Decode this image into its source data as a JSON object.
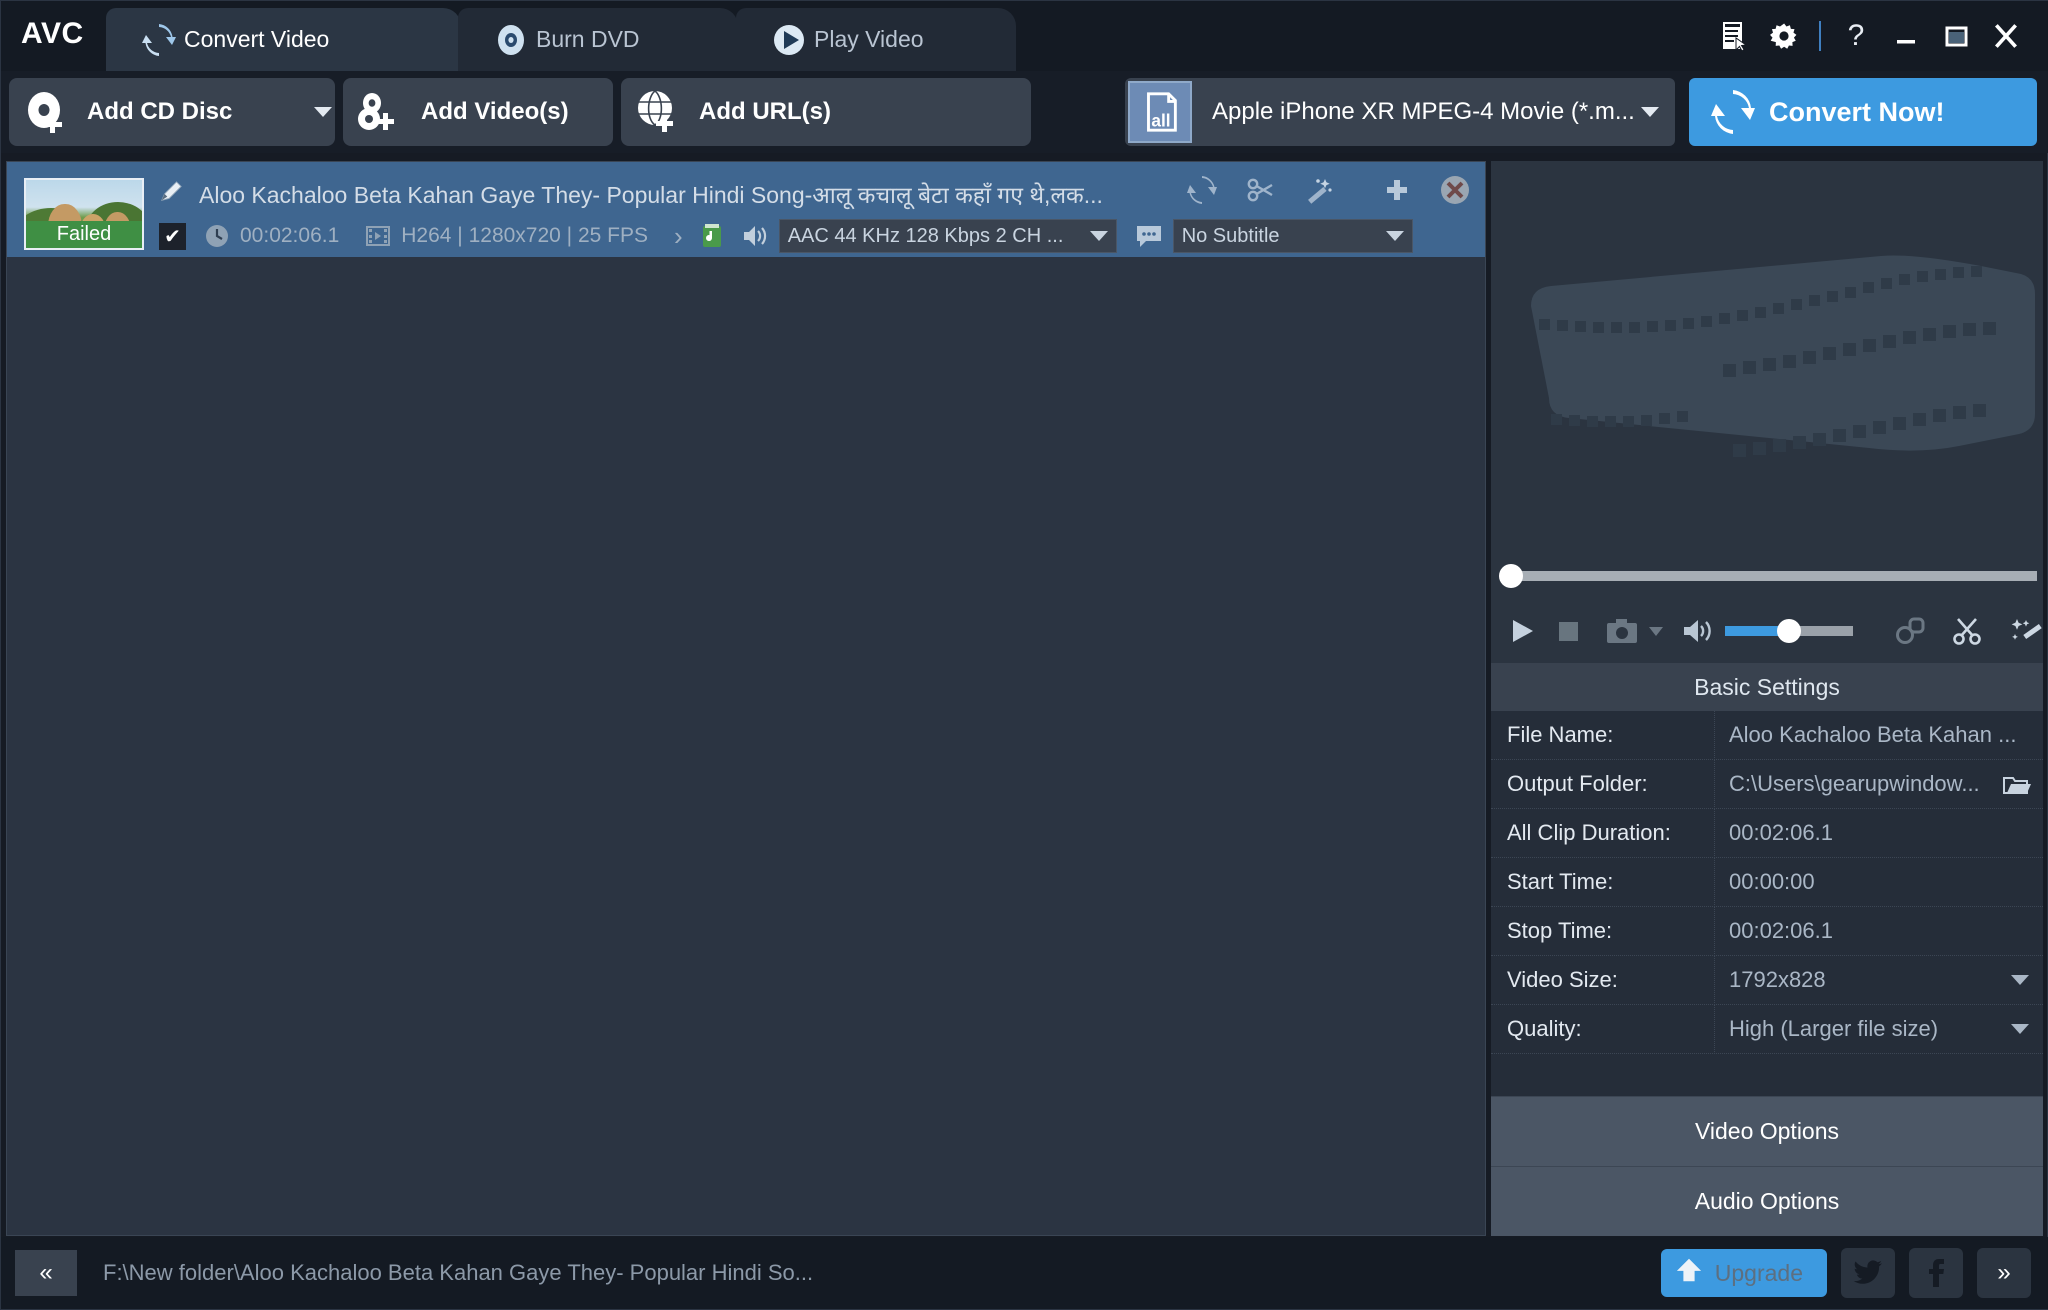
{
  "app": {
    "logo": "AVC",
    "tabs": [
      {
        "label": "Convert Video",
        "icon": "convert-icon",
        "active": true
      },
      {
        "label": "Burn DVD",
        "icon": "disc-icon",
        "active": false
      },
      {
        "label": "Play Video",
        "icon": "play-circle-icon",
        "active": false
      }
    ],
    "window_controls": [
      {
        "name": "log-icon",
        "glyph": "log"
      },
      {
        "name": "gear-icon",
        "glyph": "gear"
      },
      {
        "name": "help-icon",
        "glyph": "?"
      },
      {
        "name": "minimize-icon",
        "glyph": "—"
      },
      {
        "name": "maximize-icon",
        "glyph": "□"
      },
      {
        "name": "close-icon",
        "glyph": "✕"
      }
    ]
  },
  "toolbar": {
    "add_cd_disc": "Add CD Disc",
    "add_videos": "Add Video(s)",
    "add_urls": "Add URL(s)",
    "profile": "Apple iPhone XR MPEG-4 Movie (*.m...",
    "convert_now": "Convert Now!"
  },
  "file_item": {
    "status_badge": "Failed",
    "title": "Aloo Kachaloo Beta Kahan Gaye They- Popular Hindi Song-आलू कचालू बेटा कहाँ गए थे,लक...",
    "checked": true,
    "duration": "00:02:06.1",
    "video_info": "H264 | 1280x720 | 25 FPS",
    "audio_track": "AAC 44 KHz 128 Kbps 2 CH ...",
    "subtitle": "No Subtitle",
    "row_icons": [
      {
        "name": "rotate-icon"
      },
      {
        "name": "scissors-icon"
      },
      {
        "name": "magic-wand-icon"
      },
      {
        "name": "add-icon"
      },
      {
        "name": "remove-icon"
      }
    ]
  },
  "player": {
    "controls": [
      {
        "name": "play-icon"
      },
      {
        "name": "stop-icon"
      },
      {
        "name": "snapshot-icon"
      },
      {
        "name": "snapshot-dropdown-icon"
      },
      {
        "name": "volume-icon"
      },
      {
        "name": "merge-icon"
      },
      {
        "name": "cut-icon"
      },
      {
        "name": "effects-icon"
      }
    ],
    "seek_position_percent": 0,
    "volume_percent": 45
  },
  "basic_settings": {
    "header": "Basic Settings",
    "rows": [
      {
        "label": "File Name:",
        "value": "Aloo Kachaloo Beta Kahan ...",
        "dropdown": false,
        "folder": false
      },
      {
        "label": "Output Folder:",
        "value": "C:\\Users\\gearupwindow...",
        "dropdown": false,
        "folder": true
      },
      {
        "label": "All Clip Duration:",
        "value": "00:02:06.1",
        "dropdown": false,
        "folder": false
      },
      {
        "label": "Start Time:",
        "value": "00:00:00",
        "dropdown": false,
        "folder": false
      },
      {
        "label": "Stop Time:",
        "value": "00:02:06.1",
        "dropdown": false,
        "folder": false
      },
      {
        "label": "Video Size:",
        "value": "1792x828",
        "dropdown": true,
        "folder": false
      },
      {
        "label": "Quality:",
        "value": "High (Larger file size)",
        "dropdown": true,
        "folder": false
      }
    ],
    "video_options": "Video Options",
    "audio_options": "Audio Options"
  },
  "statusbar": {
    "collapse": "«",
    "path": "F:\\New folder\\Aloo Kachaloo Beta Kahan Gaye They- Popular Hindi So...",
    "upgrade": "Upgrade",
    "expand": "»",
    "social": [
      {
        "name": "twitter-icon"
      },
      {
        "name": "facebook-icon"
      }
    ]
  },
  "colors": {
    "accent": "#3d9ae0",
    "selected_row": "#3f6690",
    "status_failed": "#3f8f44",
    "panel": "#252d39",
    "titlebar": "#141a23"
  }
}
